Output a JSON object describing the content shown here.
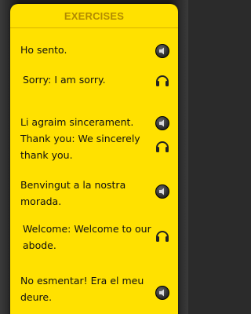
{
  "header": {
    "title": "EXERCISES"
  },
  "phrases": [
    {
      "native": [
        "Ho sento."
      ],
      "english": [
        "Sorry: I am sorry."
      ]
    },
    {
      "native": [
        "Li agraim sincerament."
      ],
      "english": [
        "Thank you: We sincerely",
        "thank you."
      ]
    },
    {
      "native": [
        "Benvingut a la nostra",
        "morada."
      ],
      "english": [
        "Welcome: Welcome to our",
        "abode."
      ]
    },
    {
      "native": [
        "No esmentar! Era el meu",
        "deure."
      ],
      "english": []
    }
  ],
  "icons": {
    "speaker": "speaker-icon",
    "headphones": "headphones-icon"
  },
  "colors": {
    "panel": "#ffe100",
    "title": "#b28b00",
    "text": "#111111"
  }
}
